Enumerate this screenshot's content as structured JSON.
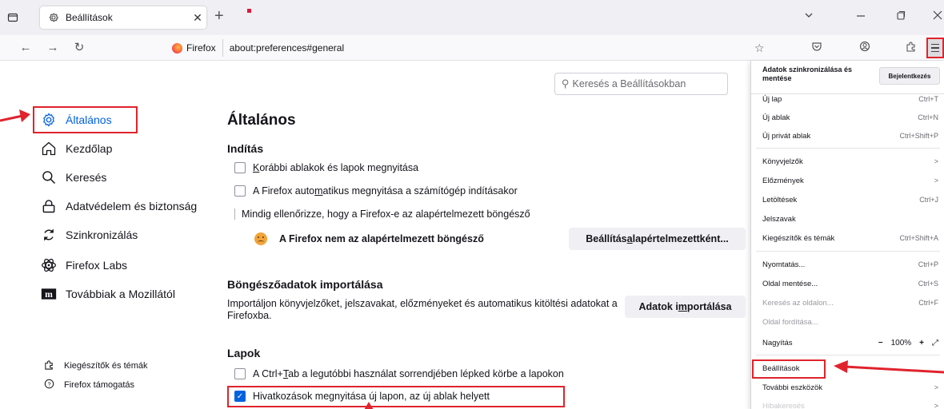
{
  "browser": {
    "tab_title": "Beállítások",
    "firefox_badge": "Firefox",
    "url": "about:preferences#general"
  },
  "search": {
    "placeholder": "Keresés a Beállításokban"
  },
  "sidebar": {
    "items": [
      {
        "label": "Általános",
        "icon": "gear-icon"
      },
      {
        "label": "Kezdőlap",
        "icon": "home-icon"
      },
      {
        "label": "Keresés",
        "icon": "search-icon"
      },
      {
        "label": "Adatvédelem és biztonság",
        "icon": "lock-icon"
      },
      {
        "label": "Szinkronizálás",
        "icon": "sync-icon"
      },
      {
        "label": "Firefox Labs",
        "icon": "labs-icon"
      },
      {
        "label": "Továbbiak a Mozillától",
        "icon": "mozilla-icon"
      }
    ],
    "footer": [
      {
        "label": "Kiegészítők és témák",
        "icon": "puzzle-icon"
      },
      {
        "label": "Firefox támogatás",
        "icon": "help-icon"
      }
    ]
  },
  "main": {
    "title": "Általános",
    "startup": {
      "heading": "Indítás",
      "restore_pre": "",
      "restore_u": "K",
      "restore_post": "orábbi ablakok és lapok megnyitása",
      "autostart_pre": "A Firefox auto",
      "autostart_u": "m",
      "autostart_post": "atikus megnyitása a számítógép indításakor",
      "check_default": "Mindig ellenőrizze, hogy a Firefox-e az alapértelmezett böngésző",
      "not_default": "A Firefox nem az alapértelmezett böngésző",
      "set_default_pre": "Beállítás ",
      "set_default_u": "a",
      "set_default_post": "lapértelmezettként..."
    },
    "import": {
      "heading": "Böngészőadatok importálása",
      "description": "Importáljon könyvjelzőket, jelszavakat, előzményeket és automatikus kitöltési adatokat a Firefoxba.",
      "button_pre": "Adatok i",
      "button_u": "m",
      "button_post": "portálása"
    },
    "tabs": {
      "heading": "Lapok",
      "ctrl_tab_pre": "A Ctrl+",
      "ctrl_tab_u": "T",
      "ctrl_tab_post": "ab a legutóbbi használat sorrendjében lépked körbe a lapokon",
      "open_links": "Hivatkozások megnyitása új lapon, az új ablak helyett",
      "open_links_checked": true
    }
  },
  "menu": {
    "sync_title": "Adatok szinkronizálása és mentése",
    "sign_in": "Bejelentkezés",
    "items": [
      {
        "label": "Új lap",
        "shortcut": "Ctrl+T"
      },
      {
        "label": "Új ablak",
        "shortcut": "Ctrl+N"
      },
      {
        "label": "Új privát ablak",
        "shortcut": "Ctrl+Shift+P"
      },
      {
        "label": "Könyvjelzők",
        "shortcut": ">"
      },
      {
        "label": "Előzmények",
        "shortcut": ">"
      },
      {
        "label": "Letöltések",
        "shortcut": "Ctrl+J"
      },
      {
        "label": "Jelszavak",
        "shortcut": ""
      },
      {
        "label": "Kiegészítők és témák",
        "shortcut": "Ctrl+Shift+A"
      },
      {
        "label": "Nyomtatás...",
        "shortcut": "Ctrl+P"
      },
      {
        "label": "Oldal mentése...",
        "shortcut": "Ctrl+S"
      },
      {
        "label": "Keresés az oldalon...",
        "shortcut": "Ctrl+F"
      },
      {
        "label": "Oldal fordítása...",
        "shortcut": ""
      },
      {
        "label": "Nagyítás",
        "zoom_minus": "−",
        "zoom_value": "100%",
        "zoom_plus": "+",
        "zoom_full": "⤢"
      },
      {
        "label": "Beállítások",
        "shortcut": ""
      },
      {
        "label": "További eszközök",
        "shortcut": ">"
      },
      {
        "label": "Hibakeresés",
        "shortcut": ">"
      }
    ]
  },
  "colors": {
    "accent": "#0061e0",
    "annotation_red": "#e0232c"
  }
}
